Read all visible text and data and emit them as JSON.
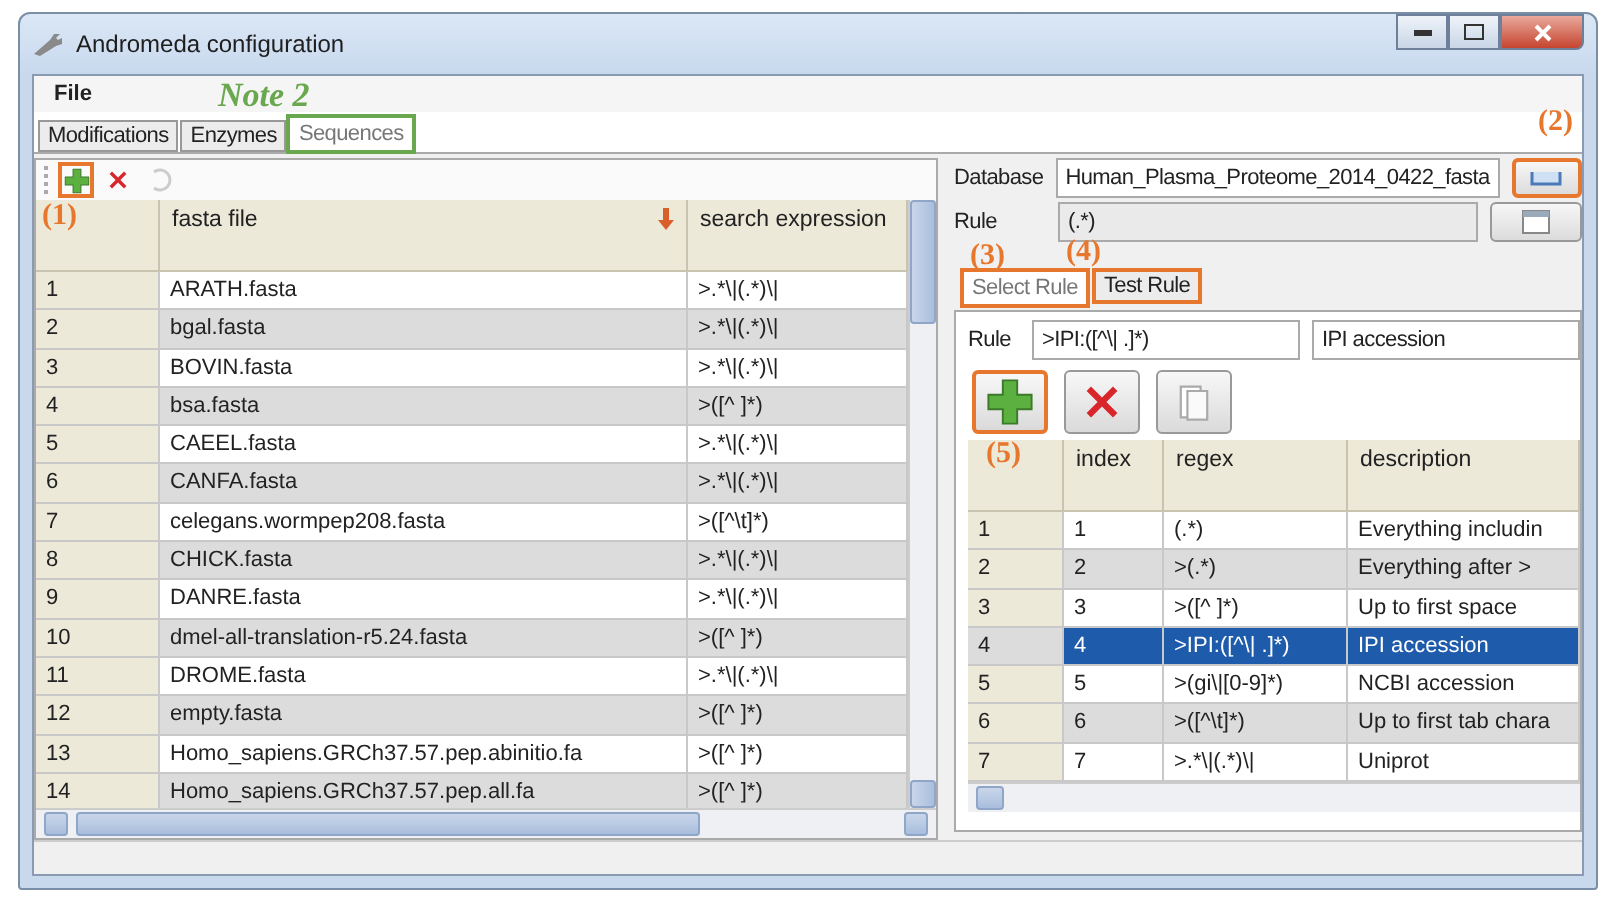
{
  "window": {
    "title": "Andromeda configuration"
  },
  "menu": [
    "File"
  ],
  "tabs": [
    {
      "label": "Modifications",
      "selected": false,
      "highlighted": false
    },
    {
      "label": "Enzymes",
      "selected": false,
      "highlighted": false
    },
    {
      "label": "Sequences",
      "selected": true,
      "highlighted": true
    }
  ],
  "toolbar": {
    "add_highlighted": true
  },
  "sequences_table": {
    "columns": [
      "fasta file",
      "search expression"
    ],
    "rows": [
      {
        "number": "1",
        "file": "ARATH.fasta",
        "expression": ">.*\\|(.*)\\|"
      },
      {
        "number": "2",
        "file": "bgal.fasta",
        "expression": ">.*\\|(.*)\\|"
      },
      {
        "number": "3",
        "file": "BOVIN.fasta",
        "expression": ">.*\\|(.*)\\|"
      },
      {
        "number": "4",
        "file": "bsa.fasta",
        "expression": ">([^ ]*)"
      },
      {
        "number": "5",
        "file": "CAEEL.fasta",
        "expression": ">.*\\|(.*)\\|"
      },
      {
        "number": "6",
        "file": "CANFA.fasta",
        "expression": ">.*\\|(.*)\\|"
      },
      {
        "number": "7",
        "file": "celegans.wormpep208.fasta",
        "expression": ">([^\\t]*)"
      },
      {
        "number": "8",
        "file": "CHICK.fasta",
        "expression": ">.*\\|(.*)\\|"
      },
      {
        "number": "9",
        "file": "DANRE.fasta",
        "expression": ">.*\\|(.*)\\|"
      },
      {
        "number": "10",
        "file": "dmel-all-translation-r5.24.fasta",
        "expression": ">([^ ]*)"
      },
      {
        "number": "11",
        "file": "DROME.fasta",
        "expression": ">.*\\|(.*)\\|"
      },
      {
        "number": "12",
        "file": "empty.fasta",
        "expression": ">([^ ]*)"
      },
      {
        "number": "13",
        "file": "Homo_sapiens.GRCh37.57.pep.abinitio.fa",
        "expression": ">([^ ]*)"
      },
      {
        "number": "14",
        "file": "Homo_sapiens.GRCh37.57.pep.all.fa",
        "expression": ">([^ ]*)"
      }
    ]
  },
  "database": {
    "label": "Database",
    "value": "Human_Plasma_Proteome_2014_0422_fasta",
    "button_highlighted": true
  },
  "rule": {
    "label": "Rule",
    "value": "(.*)"
  },
  "rule_tabs": [
    {
      "label": "Select Rule",
      "selected": true,
      "highlighted": true
    },
    {
      "label": "Test Rule",
      "selected": false,
      "highlighted": true
    }
  ],
  "rule_editor": {
    "label": "Rule",
    "regex": ">IPI:([^\\| .]*)",
    "description": "IPI accession",
    "add_highlighted": true
  },
  "rules_table": {
    "columns": [
      "index",
      "regex",
      "description"
    ],
    "rows": [
      {
        "number": "1",
        "index": "1",
        "regex": "(.*)",
        "description": "Everything includin",
        "selected": false
      },
      {
        "number": "2",
        "index": "2",
        "regex": ">(.*)",
        "description": "Everything after >",
        "selected": false
      },
      {
        "number": "3",
        "index": "3",
        "regex": ">([^ ]*)",
        "description": "Up to first space",
        "selected": false
      },
      {
        "number": "4",
        "index": "4",
        "regex": ">IPI:([^\\| .]*)",
        "description": "IPI accession",
        "selected": true
      },
      {
        "number": "5",
        "index": "5",
        "regex": ">(gi\\|[0-9]*)",
        "description": "NCBI accession",
        "selected": false
      },
      {
        "number": "6",
        "index": "6",
        "regex": ">([^\\t]*)",
        "description": "Up to first tab chara",
        "selected": false
      },
      {
        "number": "7",
        "index": "7",
        "regex": ">.*\\|(.*)\\|",
        "description": "Uniprot",
        "selected": false
      }
    ]
  },
  "annotations": [
    {
      "label": "Note 2",
      "kind": "note"
    },
    {
      "label": "(1)",
      "kind": "step"
    },
    {
      "label": "(2)",
      "kind": "step"
    },
    {
      "label": "(3)",
      "kind": "step"
    },
    {
      "label": "(4)",
      "kind": "step"
    },
    {
      "label": "(5)",
      "kind": "step"
    }
  ]
}
